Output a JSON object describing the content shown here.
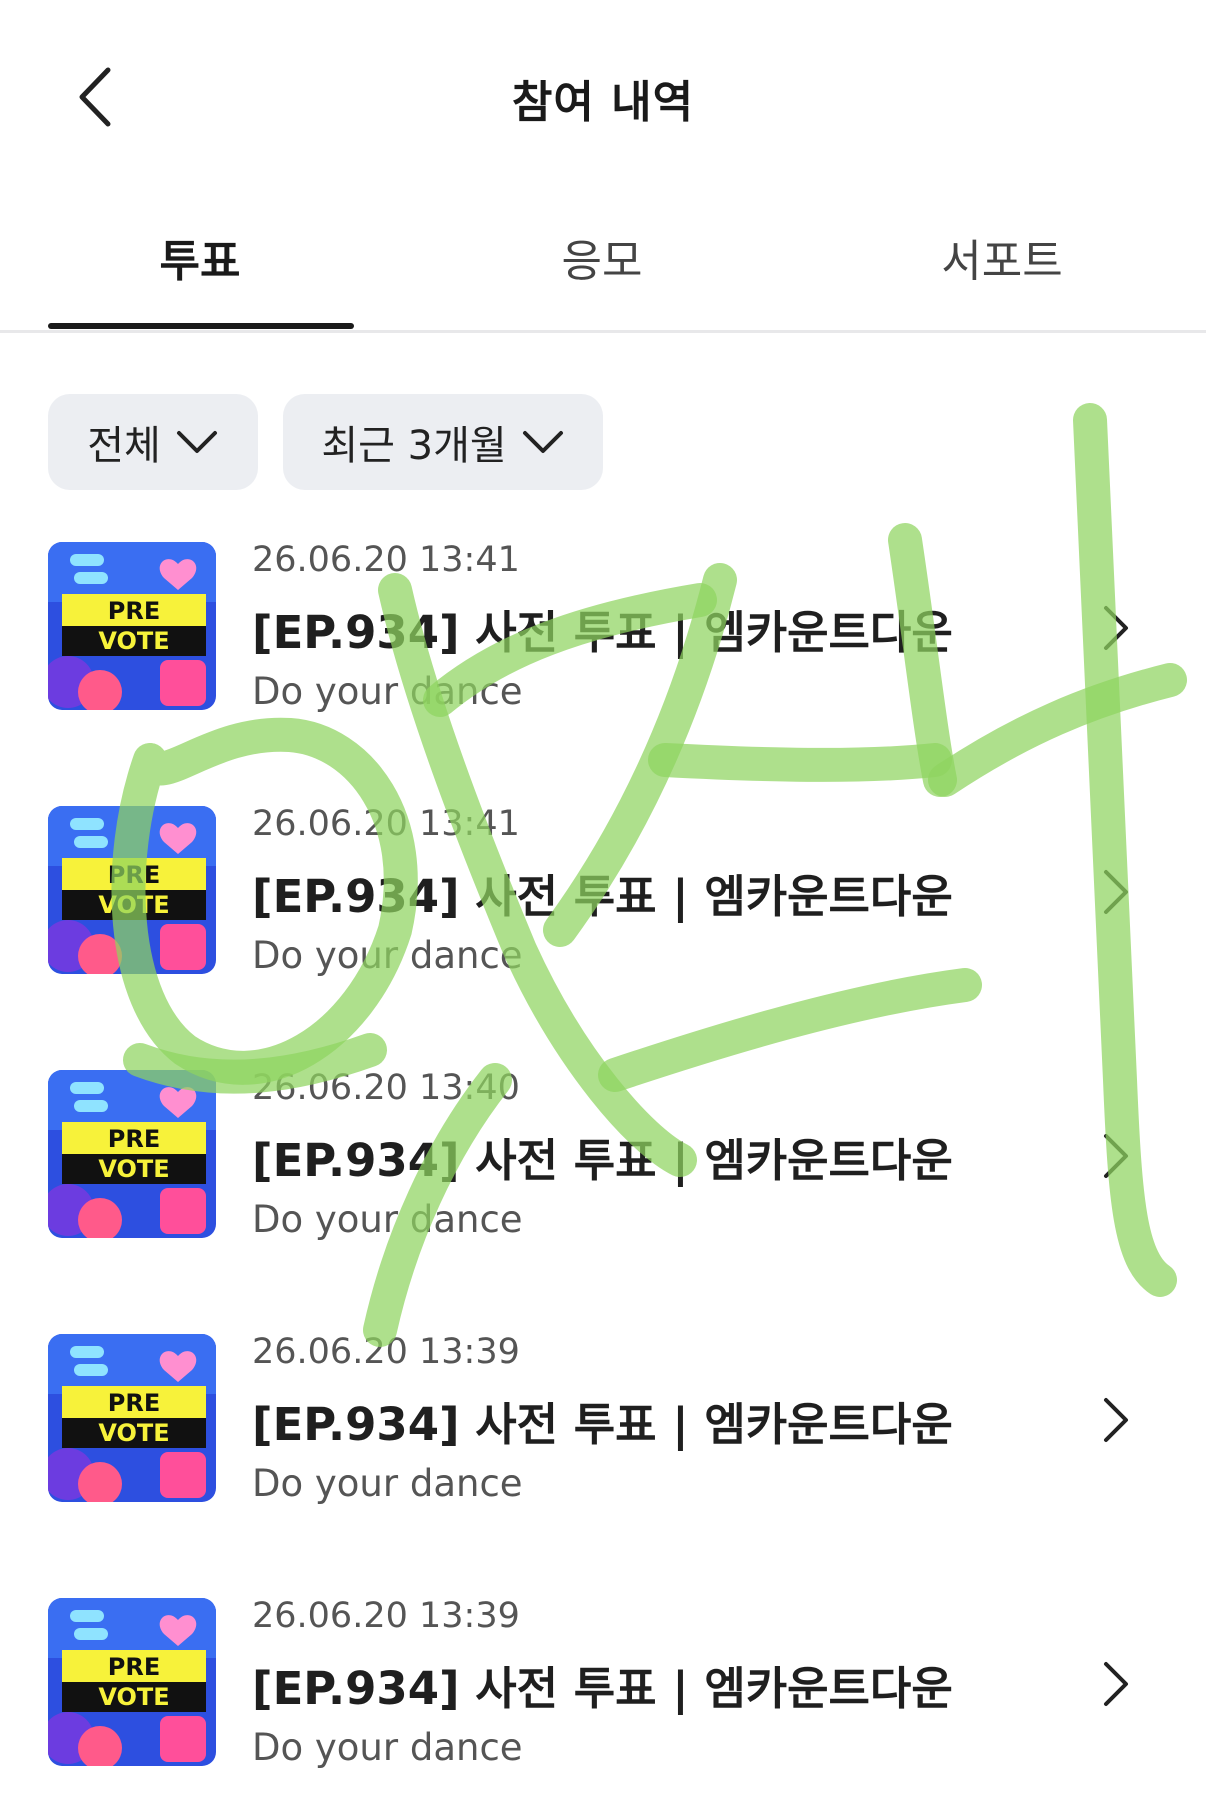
{
  "header": {
    "title": "참여 내역"
  },
  "tabs": [
    {
      "label": "투표",
      "active": true
    },
    {
      "label": "응모",
      "active": false
    },
    {
      "label": "서포트",
      "active": false
    }
  ],
  "filters": [
    {
      "label": "전체"
    },
    {
      "label": "최근 3개월"
    }
  ],
  "thumbnail": {
    "line1": "PRE",
    "line2": "VOTE"
  },
  "items": [
    {
      "date": "26.06.20 13:41",
      "title": "[EP.934] 사전 투표 | 엠카운트다운",
      "subtitle": "Do your dance"
    },
    {
      "date": "26.06.20 13:41",
      "title": "[EP.934] 사전 투표 | 엠카운트다운",
      "subtitle": "Do your dance"
    },
    {
      "date": "26.06.20 13:40",
      "title": "[EP.934] 사전 투표 | 엠카운트다운",
      "subtitle": "Do your dance"
    },
    {
      "date": "26.06.20 13:39",
      "title": "[EP.934] 사전 투표 | 엠카운트다운",
      "subtitle": "Do your dance"
    },
    {
      "date": "26.06.20 13:39",
      "title": "[EP.934] 사전 투표 | 엠카운트다운",
      "subtitle": "Do your dance"
    }
  ],
  "colors": {
    "accent": "#1a1a1a",
    "chip_bg": "#eceef2",
    "scribble": "#8fd460"
  },
  "icons": {
    "back": "chevron-left-icon",
    "dropdown": "chevron-down-icon",
    "row": "chevron-right-icon"
  }
}
